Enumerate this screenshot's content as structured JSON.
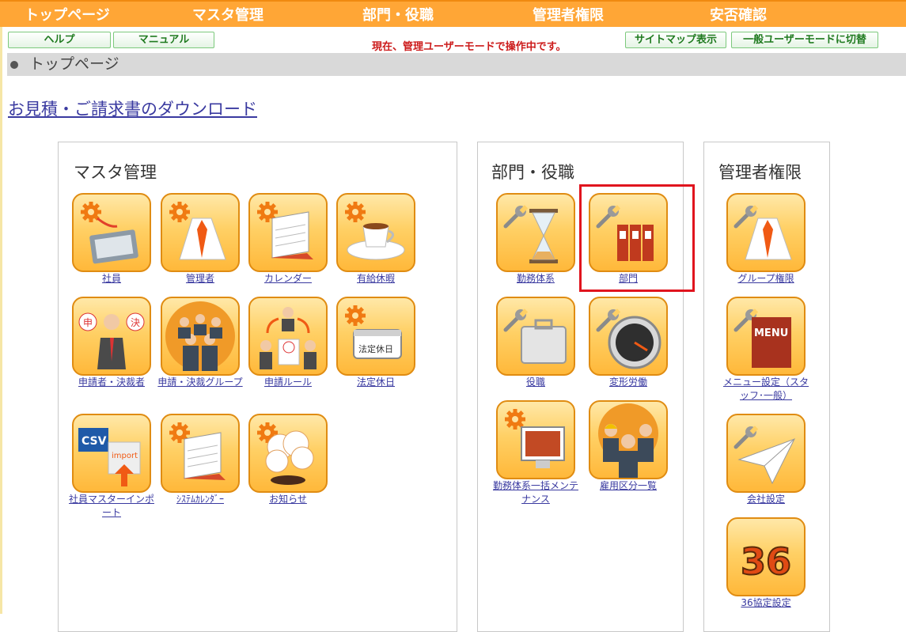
{
  "topnav": {
    "items": [
      "トップページ",
      "マスタ管理",
      "部門・役職",
      "管理者権限",
      "安否確認"
    ]
  },
  "toolbar": {
    "help": "ヘルプ",
    "manual": "マニュアル",
    "mode_message": "現在、管理ユーザーモードで操作中です。",
    "sitemap": "サイトマップ表示",
    "switch_mode": "一般ユーザーモードに切替"
  },
  "breadcrumb": {
    "current": "トップページ"
  },
  "download_link": "お見積・ご請求書のダウンロード",
  "panels": {
    "master": {
      "title": "マスタ管理",
      "tiles": [
        {
          "label": "社員",
          "icon": "id-card-icon"
        },
        {
          "label": "管理者",
          "icon": "shirt-tie-icon"
        },
        {
          "label": "カレンダー",
          "icon": "calendar-icon"
        },
        {
          "label": "有給休暇",
          "icon": "coffee-cup-icon"
        },
        {
          "label": "申請者・決裁者",
          "icon": "applicant-approver-icon"
        },
        {
          "label": "申請・決裁グループ",
          "icon": "group-people-icon"
        },
        {
          "label": "申請ルール",
          "icon": "request-rule-icon"
        },
        {
          "label": "法定休日",
          "icon": "holiday-calendar-icon"
        },
        {
          "label": "社員マスターインポート",
          "icon": "csv-import-icon"
        },
        {
          "label": "ｼｽﾃﾑｶﾚﾝﾀﾞｰ",
          "icon": "system-calendar-icon"
        },
        {
          "label": "お知らせ",
          "icon": "notice-cloud-icon"
        }
      ]
    },
    "dept": {
      "title": "部門・役職",
      "tiles": [
        {
          "label": "勤務体系",
          "icon": "hourglass-icon"
        },
        {
          "label": "部門",
          "icon": "binders-icon"
        },
        {
          "label": "役職",
          "icon": "briefcase-icon"
        },
        {
          "label": "変形労働",
          "icon": "gauge-icon"
        },
        {
          "label": "勤務体系一括メンテナンス",
          "icon": "monitor-icon"
        },
        {
          "label": "雇用区分一覧",
          "icon": "workers-icon"
        }
      ]
    },
    "admin": {
      "title": "管理者権限",
      "tiles": [
        {
          "label": "グループ権限",
          "icon": "shirt-tie-icon"
        },
        {
          "label": "メニュー設定（スタッフ･一般）",
          "icon": "menu-book-icon"
        },
        {
          "label": "会社設定",
          "icon": "paper-plane-icon"
        },
        {
          "label": "36協定設定",
          "icon": "number-36-icon"
        }
      ]
    }
  },
  "colors": {
    "nav_bg": "#ffa636",
    "link": "#3a3aa0",
    "mode_message": "#cc1b1b",
    "highlight": "#e0141e",
    "button_text": "#1f7a1f"
  }
}
